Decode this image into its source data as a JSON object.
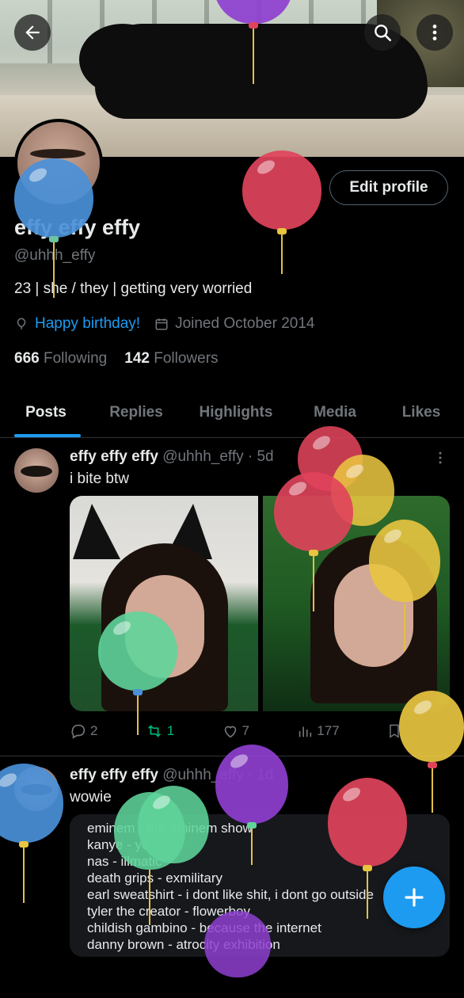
{
  "header": {
    "back_label": "Back",
    "search_label": "Search",
    "more_label": "More"
  },
  "profile": {
    "edit_label": "Edit profile",
    "name": "effy effy effy",
    "handle": "@uhhh_effy",
    "bio": "23 | she / they | getting very worried",
    "birthday": "Happy birthday!",
    "joined": "Joined October 2014",
    "following_count": "666",
    "following_label": "Following",
    "followers_count": "142",
    "followers_label": "Followers"
  },
  "tabs": [
    {
      "label": "Posts"
    },
    {
      "label": "Replies"
    },
    {
      "label": "Highlights"
    },
    {
      "label": "Media"
    },
    {
      "label": "Likes"
    }
  ],
  "posts": [
    {
      "name": "effy effy effy",
      "meta": "@uhhh_effy · 5d",
      "text": "i bite btw",
      "replies": "2",
      "reposts": "1",
      "likes": "7",
      "views": "177"
    },
    {
      "name": "effy effy effy",
      "meta": "@uhhh_effy · 1d",
      "text": "wowie",
      "quote_lines": [
        "eminem - the eminem show",
        "kanye - ye",
        "nas - illmatic",
        "death grips - exmilitary",
        "earl sweatshirt - i dont like shit, i dont go outside",
        "tyler the creator - flowerboy",
        "childish gambino - because the internet",
        "danny brown - atrocity exhibition"
      ]
    }
  ],
  "colors": {
    "accent": "#1d9bf0",
    "repost": "#00ba7c",
    "balloon_blue": "#4a90d9",
    "balloon_red": "#e0435b",
    "balloon_yellow": "#e8c440",
    "balloon_green": "#5fd49a",
    "balloon_purple": "#8e3fcf"
  }
}
